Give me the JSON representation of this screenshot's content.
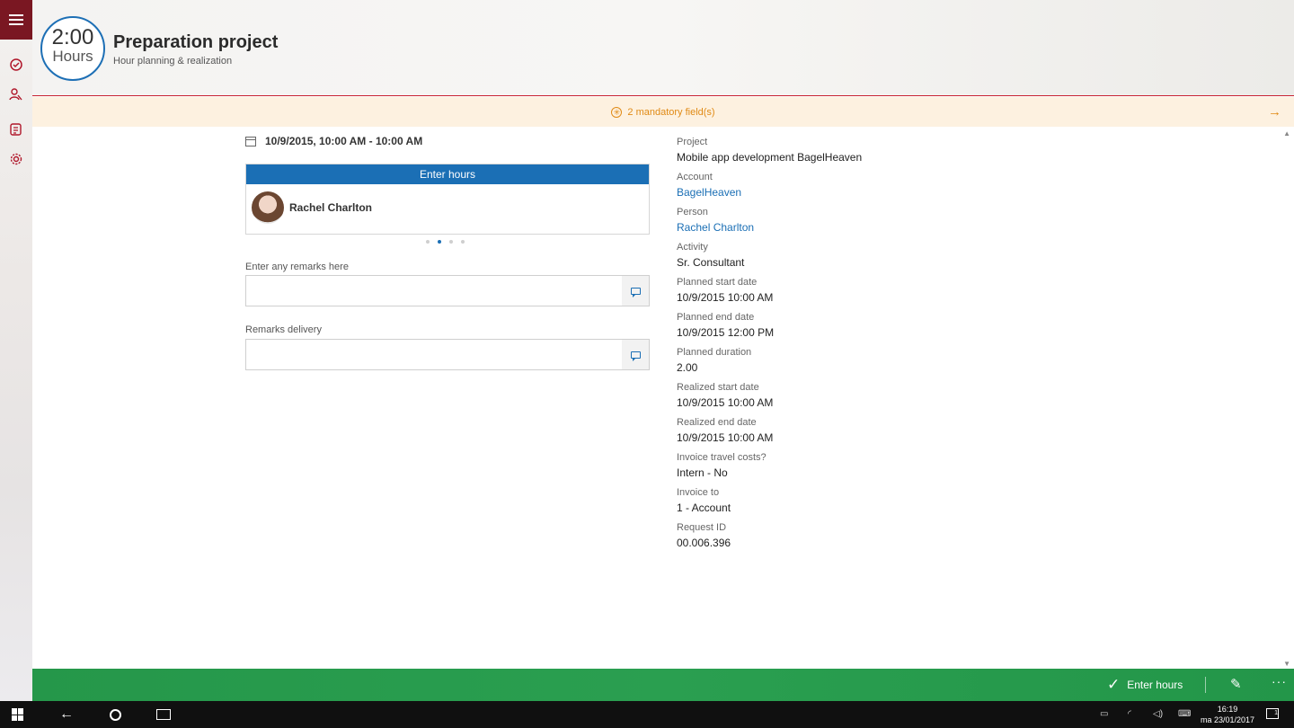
{
  "header": {
    "clock_time": "2:00",
    "clock_unit": "Hours",
    "title": "Preparation project",
    "subtitle": "Hour planning & realization"
  },
  "banner": {
    "text": "2 mandatory field(s)"
  },
  "left": {
    "datetime": "10/9/2015, 10:00 AM - 10:00 AM",
    "card_header": "Enter hours",
    "person_name": "Rachel Charlton",
    "remarks_label": "Enter any remarks here",
    "remarks_value": "",
    "delivery_label": "Remarks delivery",
    "delivery_value": ""
  },
  "details": [
    {
      "label": "Project",
      "value": "Mobile app development BagelHeaven"
    },
    {
      "label": "Account",
      "value": "BagelHeaven"
    },
    {
      "label": "Person",
      "value": "Rachel Charlton"
    },
    {
      "label": "Activity",
      "value": "Sr. Consultant"
    },
    {
      "label": "Planned start date",
      "value": "10/9/2015 10:00 AM"
    },
    {
      "label": "Planned end date",
      "value": "10/9/2015 12:00 PM"
    },
    {
      "label": "Planned duration",
      "value": "2.00"
    },
    {
      "label": "Realized start date",
      "value": "10/9/2015 10:00 AM"
    },
    {
      "label": "Realized end date",
      "value": "10/9/2015 10:00 AM"
    },
    {
      "label": "Invoice travel costs?",
      "value": "Intern - No"
    },
    {
      "label": "Invoice to",
      "value": "1 - Account"
    },
    {
      "label": "Request ID",
      "value": "00.006.396"
    }
  ],
  "appbar": {
    "enter_label": "Enter hours",
    "more": "···"
  },
  "taskbar": {
    "time": "16:19",
    "date": "ma 23/01/2017",
    "notification_count": "1"
  },
  "colors": {
    "accent": "#1b6fb5",
    "brand": "#7a1722",
    "warning": "#e08a15",
    "appbar": "#2a9f50"
  }
}
